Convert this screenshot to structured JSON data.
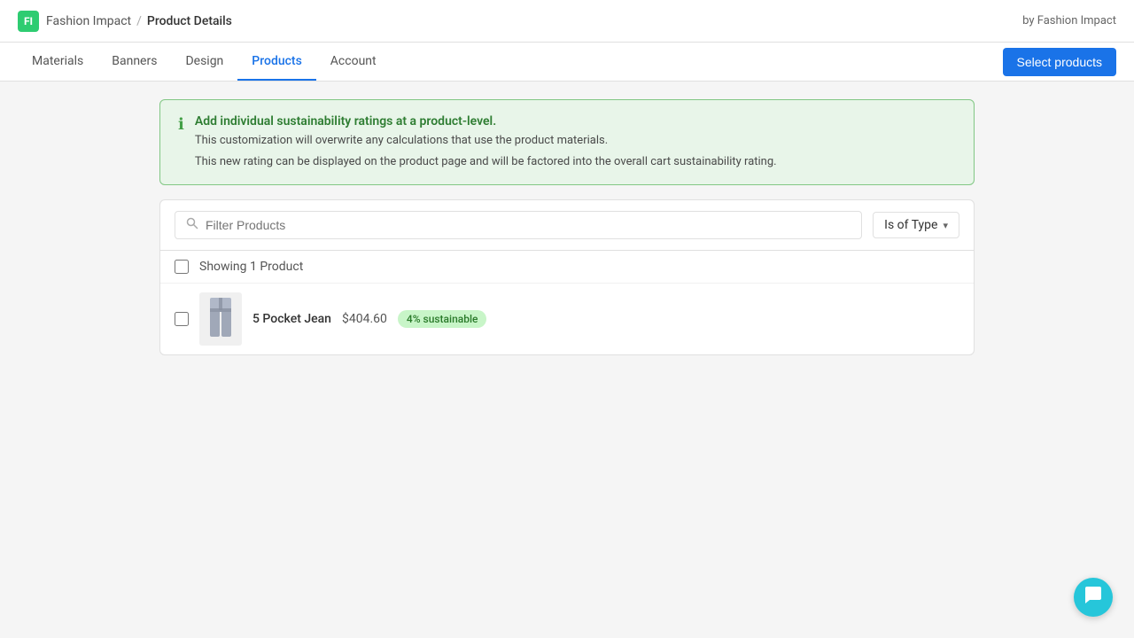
{
  "app": {
    "logo_text": "FI",
    "brand_name": "Fashion Impact",
    "separator": "/",
    "page_title": "Product Details",
    "by_label": "by Fashion Impact"
  },
  "nav": {
    "tabs": [
      {
        "id": "materials",
        "label": "Materials",
        "active": false
      },
      {
        "id": "banners",
        "label": "Banners",
        "active": false
      },
      {
        "id": "design",
        "label": "Design",
        "active": false
      },
      {
        "id": "products",
        "label": "Products",
        "active": true
      },
      {
        "id": "account",
        "label": "Account",
        "active": false
      }
    ],
    "select_products_button": "Select products"
  },
  "info_banner": {
    "title": "Add individual sustainability ratings at a product-level.",
    "line1": "This customization will overwrite any calculations that use the product materials.",
    "line2": "This new rating can be displayed on the product page and will be factored into the overall cart sustainability rating."
  },
  "search": {
    "placeholder": "Filter Products"
  },
  "filter_dropdown": {
    "label": "Is of Type",
    "chevron": "▾"
  },
  "product_count": {
    "text": "Showing 1 Product"
  },
  "products": [
    {
      "name": "5 Pocket Jean",
      "price": "$404.60",
      "sustainability": "4% sustainable"
    }
  ],
  "icons": {
    "info": "ℹ",
    "search": "🔍",
    "chat": "💬"
  },
  "colors": {
    "active_tab": "#1a73e8",
    "select_button": "#1a73e8",
    "badge_bg": "#c8f5c8",
    "badge_text": "#2a7a2a",
    "chat_bg": "#26c6da",
    "info_bg": "#e8f5e9",
    "info_border": "#81c784",
    "info_icon": "#43a047"
  }
}
